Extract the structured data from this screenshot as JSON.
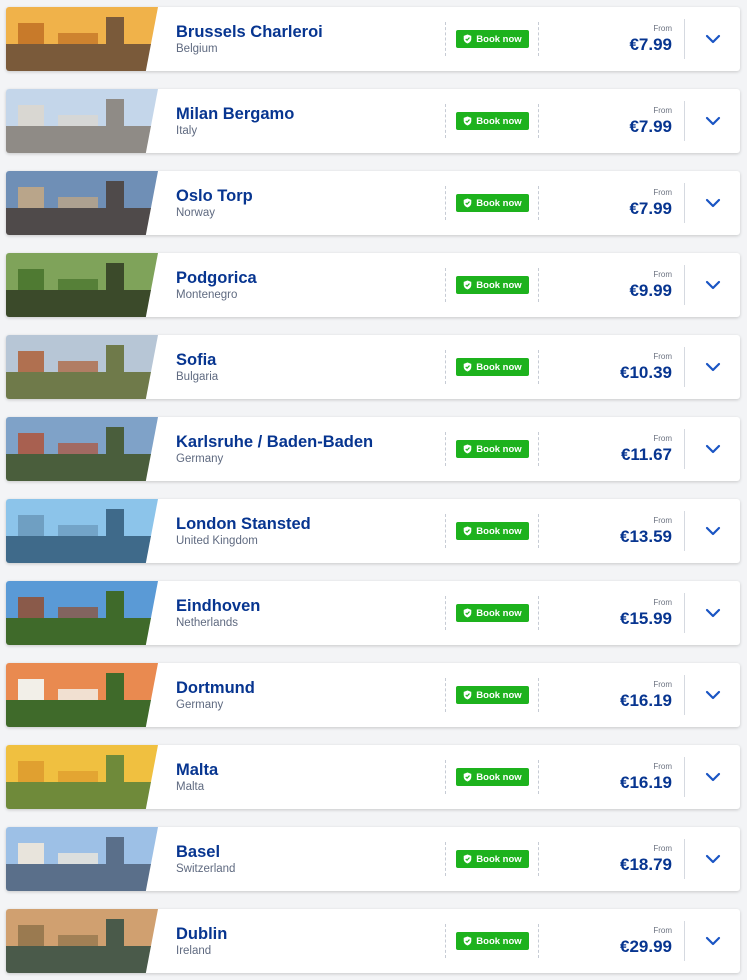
{
  "colors": {
    "brand_blue": "#073590",
    "book_green": "#1db21d",
    "chevron_blue": "#1a55c4"
  },
  "destinations": [
    {
      "city": "Brussels Charleroi",
      "country": "Belgium",
      "book_label": "Book now",
      "from_label": "From",
      "price": "€7.99",
      "thumb": [
        "#f0b24a",
        "#c87a2a",
        "#7a5a3a"
      ],
      "scene": "city-gothic-buildings"
    },
    {
      "city": "Milan Bergamo",
      "country": "Italy",
      "book_label": "Book now",
      "from_label": "From",
      "price": "€7.99",
      "thumb": [
        "#c4d6ea",
        "#d9d7d2",
        "#8f8b86"
      ],
      "scene": "cathedral"
    },
    {
      "city": "Oslo Torp",
      "country": "Norway",
      "book_label": "Book now",
      "from_label": "From",
      "price": "€7.99",
      "thumb": [
        "#6f8fb6",
        "#b9a58a",
        "#4f4a4a"
      ],
      "scene": "modern-waterfront"
    },
    {
      "city": "Podgorica",
      "country": "Montenegro",
      "book_label": "Book now",
      "from_label": "From",
      "price": "€9.99",
      "thumb": [
        "#7fa35a",
        "#4f7a32",
        "#3b4a2a"
      ],
      "scene": "green-river"
    },
    {
      "city": "Sofia",
      "country": "Bulgaria",
      "book_label": "Book now",
      "from_label": "From",
      "price": "€10.39",
      "thumb": [
        "#b7c6d6",
        "#b07050",
        "#6f7a4a"
      ],
      "scene": "fountain"
    },
    {
      "city": "Karlsruhe / Baden-Baden",
      "country": "Germany",
      "book_label": "Book now",
      "from_label": "From",
      "price": "€11.67",
      "thumb": [
        "#7fa2c8",
        "#a86050",
        "#4a5e3c"
      ],
      "scene": "town-hills"
    },
    {
      "city": "London Stansted",
      "country": "United Kingdom",
      "book_label": "Book now",
      "from_label": "From",
      "price": "€13.59",
      "thumb": [
        "#8cc4ea",
        "#6f9fc2",
        "#3f6a8a"
      ],
      "scene": "tower-bridge"
    },
    {
      "city": "Eindhoven",
      "country": "Netherlands",
      "book_label": "Book now",
      "from_label": "From",
      "price": "€15.99",
      "thumb": [
        "#5a9ad6",
        "#8a5a4a",
        "#3f6a2a"
      ],
      "scene": "church-tower"
    },
    {
      "city": "Dortmund",
      "country": "Germany",
      "book_label": "Book now",
      "from_label": "From",
      "price": "€16.19",
      "thumb": [
        "#e98a50",
        "#f2efe8",
        "#3f6a2a"
      ],
      "scene": "half-timbered"
    },
    {
      "city": "Malta",
      "country": "Malta",
      "book_label": "Book now",
      "from_label": "From",
      "price": "€16.19",
      "thumb": [
        "#f0c040",
        "#e0a030",
        "#6f8a3a"
      ],
      "scene": "yellow-houses"
    },
    {
      "city": "Basel",
      "country": "Switzerland",
      "book_label": "Book now",
      "from_label": "From",
      "price": "€18.79",
      "thumb": [
        "#9dc0e6",
        "#e8e4dc",
        "#5a6f8a"
      ],
      "scene": "old-town-river"
    },
    {
      "city": "Dublin",
      "country": "Ireland",
      "book_label": "Book now",
      "from_label": "From",
      "price": "€29.99",
      "thumb": [
        "#d0a070",
        "#9a7a50",
        "#4a5a4a"
      ],
      "scene": "stone-bridge"
    }
  ]
}
